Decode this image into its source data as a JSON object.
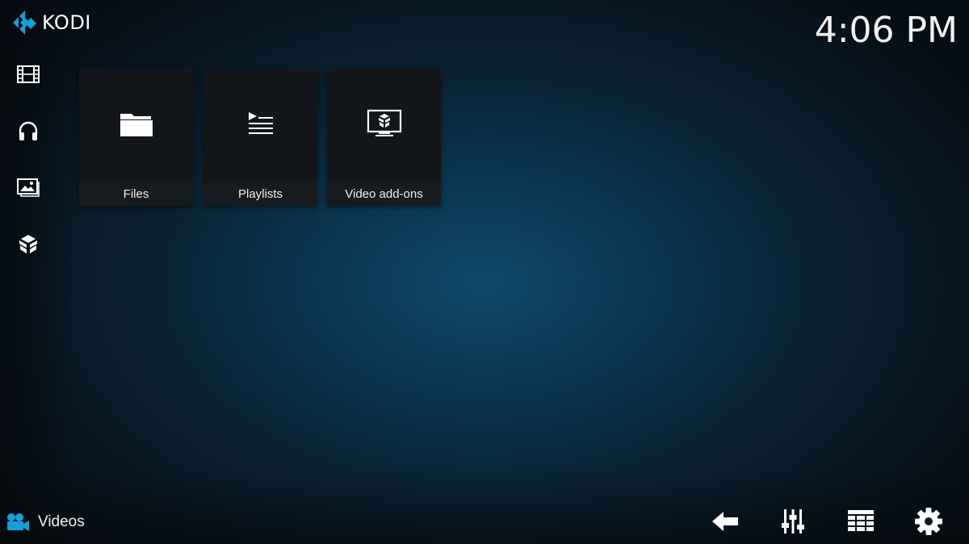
{
  "app": {
    "logo_text": "KODI",
    "accent_color": "#12a0d7"
  },
  "header": {
    "clock": "4:06 PM"
  },
  "sidebar": {
    "items": [
      {
        "icon": "movies-film-icon"
      },
      {
        "icon": "music-headphones-icon"
      },
      {
        "icon": "pictures-icon"
      },
      {
        "icon": "addons-box-icon"
      }
    ]
  },
  "tiles": [
    {
      "label": "Files",
      "icon": "folder-icon"
    },
    {
      "label": "Playlists",
      "icon": "playlist-icon"
    },
    {
      "label": "Video add-ons",
      "icon": "video-addons-icon"
    }
  ],
  "footer": {
    "section_label": "Videos",
    "section_icon": "video-camera-icon",
    "buttons": [
      {
        "icon": "back-arrow-icon"
      },
      {
        "icon": "sliders-icon"
      },
      {
        "icon": "grid-view-icon"
      },
      {
        "icon": "settings-gear-icon"
      }
    ]
  }
}
